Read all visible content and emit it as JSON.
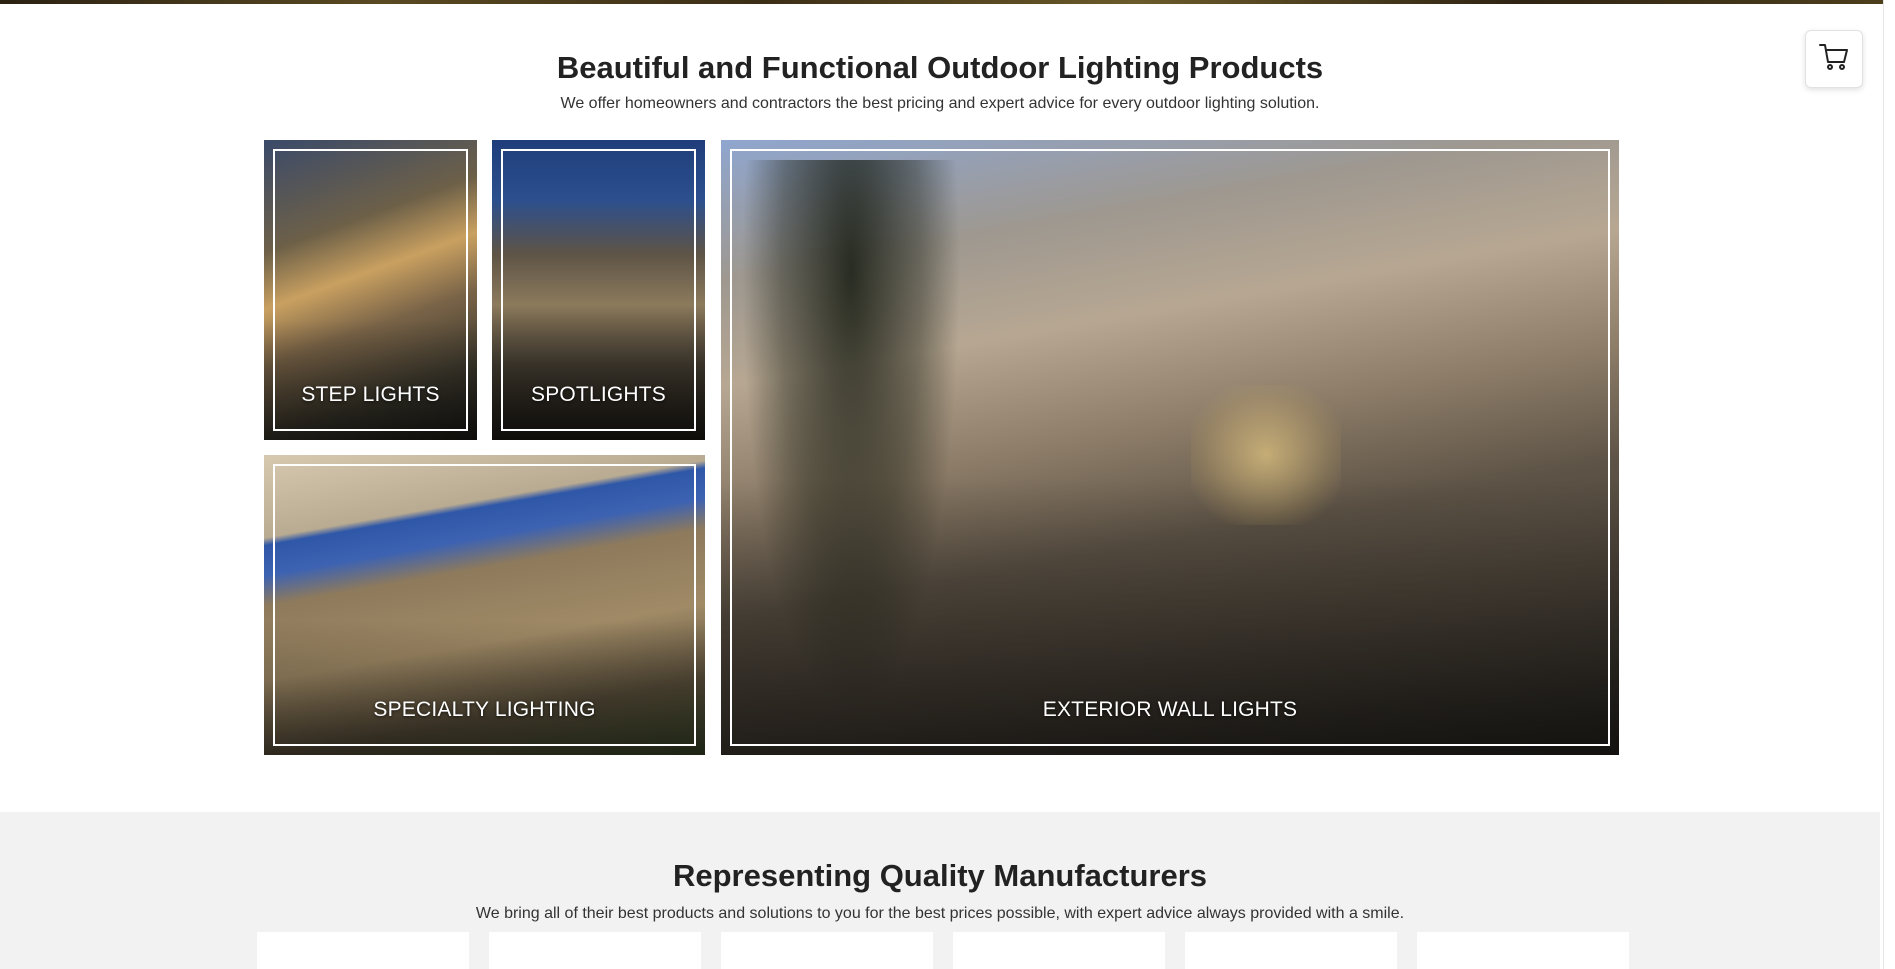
{
  "products_section": {
    "title": "Beautiful and Functional Outdoor Lighting Products",
    "subtitle": "We offer homeowners and contractors the best pricing and expert advice for every outdoor lighting solution.",
    "tiles": [
      {
        "label": "STEP LIGHTS"
      },
      {
        "label": "SPOTLIGHTS"
      },
      {
        "label": "SPECIALTY LIGHTING"
      },
      {
        "label": "EXTERIOR WALL LIGHTS"
      }
    ]
  },
  "manufacturers_section": {
    "title": "Representing Quality Manufacturers",
    "subtitle": "We bring all of their best products and solutions to you for the best prices possible, with expert advice always provided with a smile."
  },
  "cart": {
    "icon": "cart-icon"
  },
  "colors": {
    "background": "#ffffff",
    "section_gray": "#f2f2f2",
    "text": "#222222"
  }
}
